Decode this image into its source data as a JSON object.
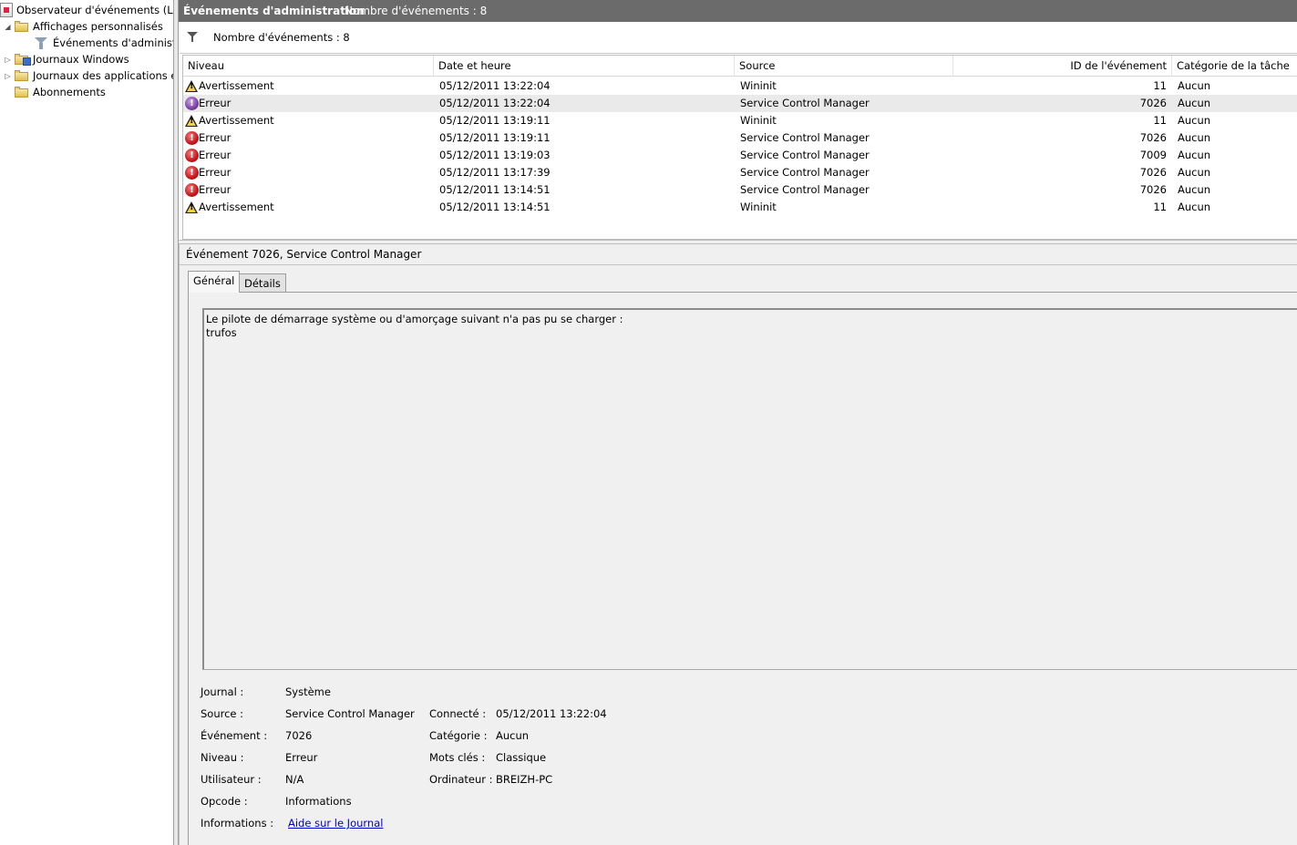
{
  "tree": {
    "items": [
      {
        "label": "Observateur d'événements (Local)",
        "icon": "event-viewer-app-icon",
        "expander": ""
      },
      {
        "label": "Affichages personnalisés",
        "icon": "folder-icon",
        "expander": "◢"
      },
      {
        "label": "Événements d'administration",
        "icon": "filter-icon",
        "expander": ""
      },
      {
        "label": "Journaux Windows",
        "icon": "folder-icon",
        "expander": "▷"
      },
      {
        "label": "Journaux des applications et",
        "icon": "folder-icon",
        "expander": "▷"
      },
      {
        "label": "Abonnements",
        "icon": "folder-icon",
        "expander": ""
      }
    ]
  },
  "header": {
    "title": "Événements d'administration",
    "count": "Nombre d'événements : 8"
  },
  "filter": {
    "text": "Nombre d'événements : 8"
  },
  "grid": {
    "columns": [
      "Niveau",
      "Date et heure",
      "Source",
      "ID de l'événement",
      "Catégorie de la tâche"
    ],
    "rows": [
      {
        "level": "Avertissement",
        "type": "warning",
        "date": "05/12/2011 13:22:04",
        "source": "Wininit",
        "id": "11",
        "category": "Aucun",
        "selected": false
      },
      {
        "level": "Erreur",
        "type": "error-purple",
        "date": "05/12/2011 13:22:04",
        "source": "Service Control Manager",
        "id": "7026",
        "category": "Aucun",
        "selected": true
      },
      {
        "level": "Avertissement",
        "type": "warning",
        "date": "05/12/2011 13:19:11",
        "source": "Wininit",
        "id": "11",
        "category": "Aucun",
        "selected": false
      },
      {
        "level": "Erreur",
        "type": "error",
        "date": "05/12/2011 13:19:11",
        "source": "Service Control Manager",
        "id": "7026",
        "category": "Aucun",
        "selected": false
      },
      {
        "level": "Erreur",
        "type": "error",
        "date": "05/12/2011 13:19:03",
        "source": "Service Control Manager",
        "id": "7009",
        "category": "Aucun",
        "selected": false
      },
      {
        "level": "Erreur",
        "type": "error",
        "date": "05/12/2011 13:17:39",
        "source": "Service Control Manager",
        "id": "7026",
        "category": "Aucun",
        "selected": false
      },
      {
        "level": "Erreur",
        "type": "error",
        "date": "05/12/2011 13:14:51",
        "source": "Service Control Manager",
        "id": "7026",
        "category": "Aucun",
        "selected": false
      },
      {
        "level": "Avertissement",
        "type": "warning",
        "date": "05/12/2011 13:14:51",
        "source": "Wininit",
        "id": "11",
        "category": "Aucun",
        "selected": false
      }
    ]
  },
  "detail": {
    "title": "Événement 7026, Service Control Manager",
    "tabs": [
      "Général",
      "Détails"
    ],
    "description_line1": "Le pilote de démarrage système ou d'amorçage suivant n'a pas pu se charger :",
    "description_line2": "trufos",
    "props": {
      "journal_label": "Journal :",
      "journal_value": "Système",
      "source_label": "Source :",
      "source_value": "Service Control Manager",
      "connecte_label": "Connecté :",
      "connecte_value": "05/12/2011 13:22:04",
      "evenement_label": "Événement :",
      "evenement_value": "7026",
      "categorie_label": "Catégorie :",
      "categorie_value": "Aucun",
      "niveau_label": "Niveau :",
      "niveau_value": "Erreur",
      "motscles_label": "Mots clés :",
      "motscles_value": "Classique",
      "utilisateur_label": "Utilisateur :",
      "utilisateur_value": "N/A",
      "ordinateur_label": "Ordinateur :",
      "ordinateur_value": "BREIZH-PC",
      "opcode_label": "Opcode :",
      "opcode_value": "Informations",
      "informations_label": "Informations :",
      "informations_link": "Aide sur le Journal"
    }
  },
  "colors": {
    "titlebar": "#6b6b6b",
    "selected_row": "#eaeaea",
    "link": "#0000cc",
    "warning": "#f6d334",
    "error": "#c8151b"
  }
}
